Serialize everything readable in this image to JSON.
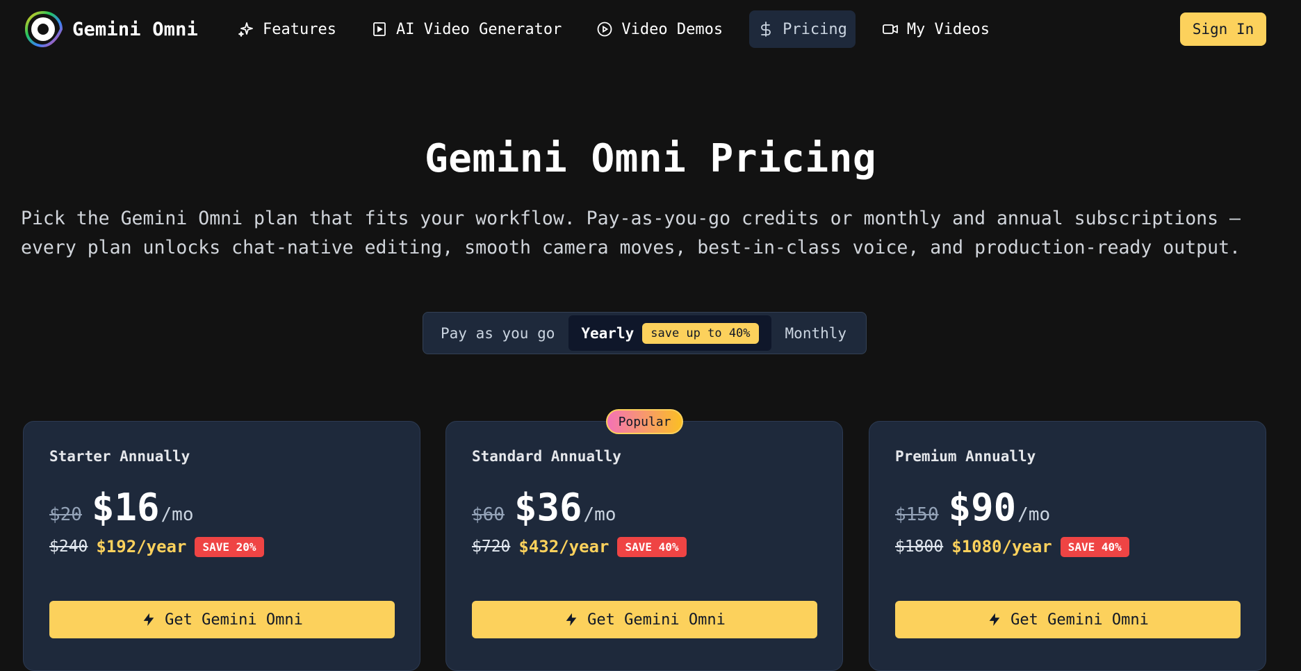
{
  "brand": {
    "name": "Gemini Omni",
    "logo_icon": "eye-ring-logo-icon"
  },
  "nav": {
    "items": [
      {
        "label": "Features",
        "icon": "sparkles-icon"
      },
      {
        "label": "AI Video Generator",
        "icon": "play-square-icon"
      },
      {
        "label": "Video Demos",
        "icon": "play-circle-icon"
      },
      {
        "label": "Pricing",
        "icon": "dollar-icon",
        "active": true
      },
      {
        "label": "My Videos",
        "icon": "video-camera-icon"
      }
    ],
    "sign_in": "Sign In"
  },
  "hero": {
    "title": "Gemini Omni Pricing",
    "subtitle": "Pick the Gemini Omni plan that fits your workflow. Pay-as-you-go credits or monthly and annual subscriptions — every plan unlocks chat-native editing, smooth camera moves, best-in-class voice, and production-ready output."
  },
  "billing_toggle": {
    "options": [
      "Pay as you go",
      "Yearly",
      "Monthly"
    ],
    "selected": "Yearly",
    "badge": "save up to 40%"
  },
  "popular_badge": "Popular",
  "plans": [
    {
      "name": "Starter Annually",
      "old_monthly": "$20",
      "monthly": "$16",
      "per": "/mo",
      "old_yearly": "$240",
      "yearly": "$192/year",
      "save": "SAVE 20%",
      "cta": "Get Gemini Omni"
    },
    {
      "name": "Standard Annually",
      "old_monthly": "$60",
      "monthly": "$36",
      "per": "/mo",
      "old_yearly": "$720",
      "yearly": "$432/year",
      "save": "SAVE 40%",
      "cta": "Get Gemini Omni"
    },
    {
      "name": "Premium Annually",
      "old_monthly": "$150",
      "monthly": "$90",
      "per": "/mo",
      "old_yearly": "$1800",
      "yearly": "$1080/year",
      "save": "SAVE 40%",
      "cta": "Get Gemini Omni"
    }
  ],
  "colors": {
    "background": "#121212",
    "accent_yellow": "#fcd15c",
    "card": "#1e293b",
    "save_red": "#ef4444"
  }
}
